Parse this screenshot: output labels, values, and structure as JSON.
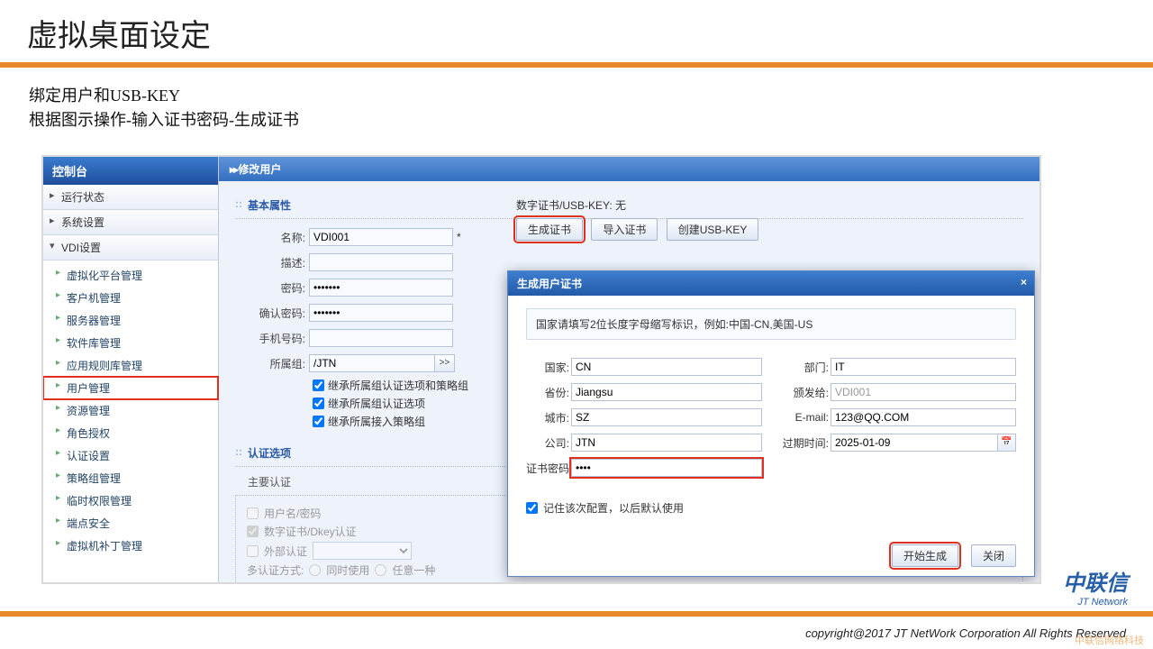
{
  "slide": {
    "title": "虚拟桌面设定",
    "desc1": "绑定用户和USB-KEY",
    "desc2": "根据图示操作-输入证书密码-生成证书"
  },
  "sidebar": {
    "panel_title": "控制台",
    "acc": [
      "运行状态",
      "系统设置",
      "VDI设置"
    ],
    "items": [
      "虚拟化平台管理",
      "客户机管理",
      "服务器管理",
      "软件库管理",
      "应用规则库管理",
      "用户管理",
      "资源管理",
      "角色授权",
      "认证设置",
      "策略组管理",
      "临时权限管理",
      "端点安全",
      "虚拟机补丁管理"
    ],
    "selected_index": 5
  },
  "main": {
    "header": "修改用户",
    "section_basic": "基本属性",
    "labels": {
      "name": "名称:",
      "desc": "描述:",
      "pwd": "密码:",
      "pwd2": "确认密码:",
      "phone": "手机号码:",
      "group": "所属组:"
    },
    "values": {
      "name": "VDI001",
      "pwd": "•••••••",
      "pwd2": "•••••••",
      "group": "/JTN"
    },
    "group_btn": ">>",
    "required": "*",
    "inherit": [
      "继承所属组认证选项和策略组",
      "继承所属组认证选项",
      "继承所属接入策略组"
    ],
    "cert_label": "数字证书/USB-KEY:",
    "cert_value": "无",
    "buttons": {
      "gen": "生成证书",
      "import": "导入证书",
      "usb": "创建USB-KEY"
    },
    "section_auth": "认证选项",
    "auth_title": "主要认证",
    "auth_opts": [
      "用户名/密码",
      "数字证书/Dkey认证",
      "外部认证"
    ],
    "multi_label": "多认证方式:",
    "multi_opts": [
      "同时使用",
      "任意一种"
    ]
  },
  "dialog": {
    "title": "生成用户证书",
    "hint": "国家请填写2位长度字母缩写标识，例如:中国-CN,美国-US",
    "labels": {
      "country": "国家:",
      "province": "省份:",
      "city": "城市:",
      "company": "公司:",
      "dept": "部门:",
      "issued": "颁发给:",
      "email": "E-mail:",
      "expire": "过期时间:",
      "certpwd": "证书密码:"
    },
    "values": {
      "country": "CN",
      "province": "Jiangsu",
      "city": "SZ",
      "company": "JTN",
      "dept": "IT",
      "issued": "VDI001",
      "email": "123@QQ.COM",
      "expire": "2025-01-09",
      "certpwd": "••••"
    },
    "remember": "记住该次配置，以后默认使用",
    "buttons": {
      "start": "开始生成",
      "close": "关闭"
    },
    "close_x": "×"
  },
  "footer": {
    "logo_cn": "中联信",
    "logo_en": "JT Network",
    "copyright": "copyright@2017  JT NetWork Corporation All Rights Reserved",
    "watermark": "中联信网络科技"
  }
}
